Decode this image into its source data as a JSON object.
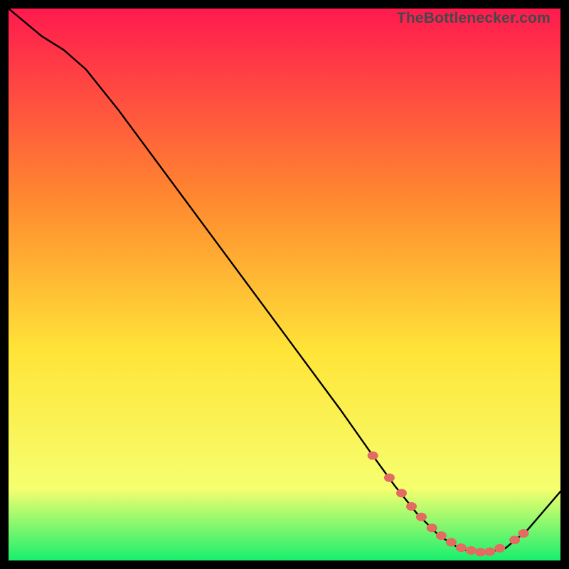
{
  "watermark": "TheBottlenecker.com",
  "chart_data": {
    "type": "line",
    "title": "",
    "xlabel": "",
    "ylabel": "",
    "xlim": [
      0,
      100
    ],
    "ylim": [
      0,
      100
    ],
    "background_gradient": {
      "top": "#ff1a4e",
      "mid_upper": "#ff8a2f",
      "mid": "#ffe438",
      "mid_lower": "#f6ff6f",
      "bottom": "#18ef6d"
    },
    "series": [
      {
        "name": "bottleneck-curve",
        "x": [
          0,
          6,
          10,
          14,
          20,
          30,
          40,
          50,
          60,
          66,
          70,
          74,
          78,
          82,
          86,
          90,
          94,
          100
        ],
        "y": [
          100,
          95,
          92.5,
          89,
          81.5,
          68,
          54.5,
          41,
          27.5,
          19,
          13.5,
          8.5,
          4.5,
          2,
          1.3,
          2.2,
          5.5,
          12.5
        ]
      }
    ],
    "markers": {
      "name": "highlight-dots",
      "color": "#e36b62",
      "points": [
        {
          "x": 66,
          "y": 19
        },
        {
          "x": 69,
          "y": 15
        },
        {
          "x": 71.2,
          "y": 12.2
        },
        {
          "x": 73,
          "y": 9.8
        },
        {
          "x": 74.8,
          "y": 7.9
        },
        {
          "x": 76.7,
          "y": 5.9
        },
        {
          "x": 78.4,
          "y": 4.5
        },
        {
          "x": 80.2,
          "y": 3.3
        },
        {
          "x": 82,
          "y": 2.3
        },
        {
          "x": 83.8,
          "y": 1.8
        },
        {
          "x": 85.5,
          "y": 1.5
        },
        {
          "x": 87.2,
          "y": 1.6
        },
        {
          "x": 89,
          "y": 2.2
        },
        {
          "x": 91.7,
          "y": 3.7
        },
        {
          "x": 93.3,
          "y": 4.9
        }
      ]
    }
  }
}
